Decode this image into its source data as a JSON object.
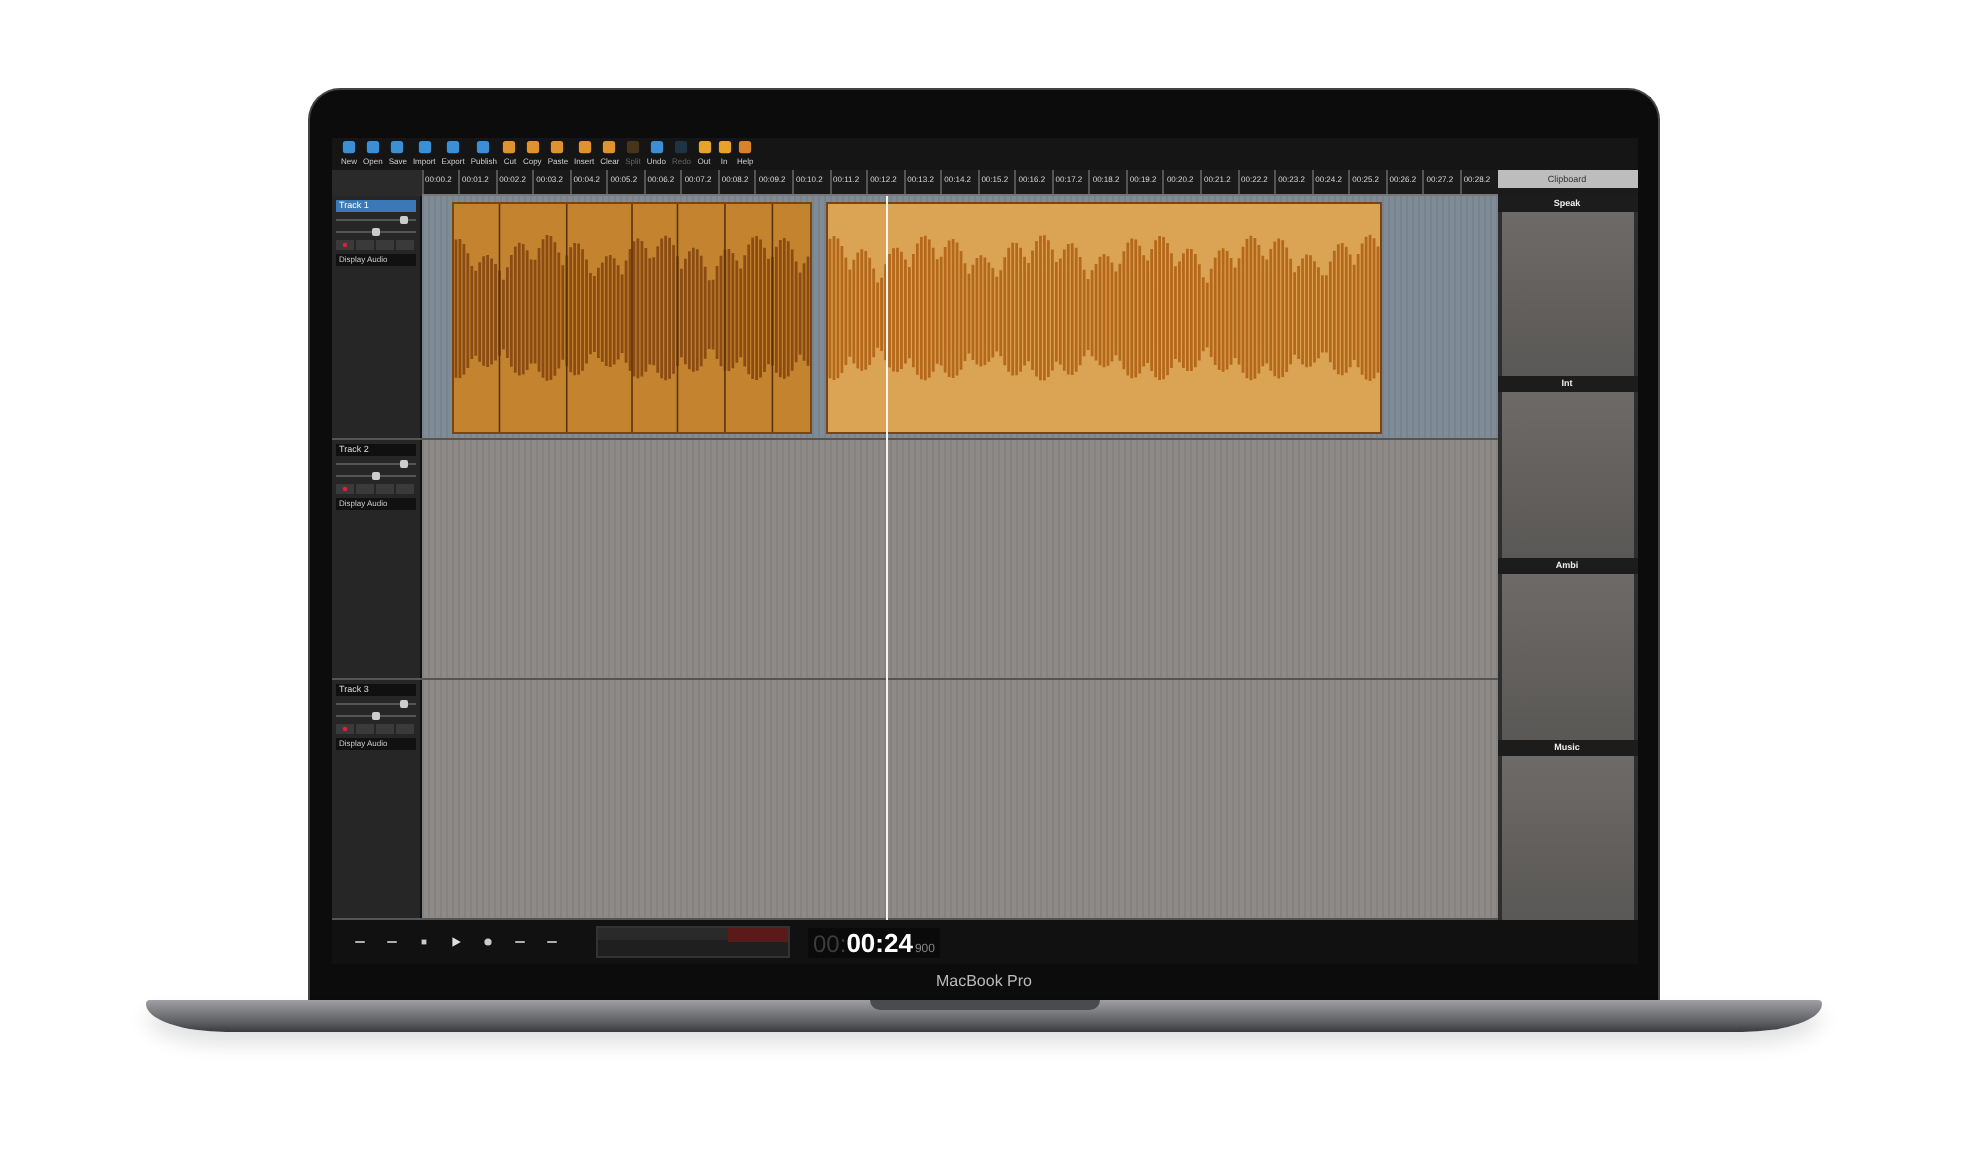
{
  "toolbar": [
    {
      "label": "New",
      "kind": "file",
      "disabled": false
    },
    {
      "label": "Open",
      "kind": "file",
      "disabled": false
    },
    {
      "label": "Save",
      "kind": "file",
      "disabled": false
    },
    {
      "label": "Import",
      "kind": "file",
      "disabled": false
    },
    {
      "label": "Export",
      "kind": "file",
      "disabled": false
    },
    {
      "label": "Publish",
      "kind": "file",
      "disabled": false
    },
    {
      "label": "Cut",
      "kind": "edit",
      "disabled": false
    },
    {
      "label": "Copy",
      "kind": "edit",
      "disabled": false
    },
    {
      "label": "Paste",
      "kind": "edit",
      "disabled": false
    },
    {
      "label": "Insert",
      "kind": "edit",
      "disabled": false
    },
    {
      "label": "Clear",
      "kind": "edit",
      "disabled": false
    },
    {
      "label": "Split",
      "kind": "edit",
      "disabled": true
    },
    {
      "label": "Undo",
      "kind": "history",
      "disabled": false
    },
    {
      "label": "Redo",
      "kind": "history",
      "disabled": true
    },
    {
      "label": "Out",
      "kind": "zoom",
      "disabled": false
    },
    {
      "label": "In",
      "kind": "zoom",
      "disabled": false
    },
    {
      "label": "Help",
      "kind": "help",
      "disabled": false
    }
  ],
  "ruler": [
    "00:00.2",
    "00:01.2",
    "00:02.2",
    "00:03.2",
    "00:04.2",
    "00:05.2",
    "00:06.2",
    "00:07.2",
    "00:08.2",
    "00:09.2",
    "00:10.2",
    "00:11.2",
    "00:12.2",
    "00:13.2",
    "00:14.2",
    "00:15.2",
    "00:16.2",
    "00:17.2",
    "00:18.2",
    "00:19.2",
    "00:20.2",
    "00:21.2",
    "00:22.2",
    "00:23.2",
    "00:24.2",
    "00:25.2",
    "00:26.2",
    "00:27.2",
    "00:28.2"
  ],
  "tracks": [
    {
      "name": "Track 1",
      "selected": true,
      "volume": {
        "level": 0.85
      },
      "pan": {
        "level": 0.5
      },
      "display": "Display Audio",
      "clips": [
        {
          "selected": false
        },
        {
          "selected": true
        }
      ]
    },
    {
      "name": "Track 2",
      "selected": false,
      "volume": {
        "level": 0.85
      },
      "pan": {
        "level": 0.5
      },
      "display": "Display Audio"
    },
    {
      "name": "Track 3",
      "selected": false,
      "volume": {
        "level": 0.85
      },
      "pan": {
        "level": 0.5
      },
      "display": "Display Audio"
    }
  ],
  "clipboard": {
    "title": "Clipboard",
    "slots": [
      {
        "label": "Speak"
      },
      {
        "label": "Int"
      },
      {
        "label": "Ambi"
      },
      {
        "label": "Music"
      }
    ]
  },
  "transport": {
    "time_prefix": "00:",
    "time": "00:24",
    "time_fraction": "900"
  },
  "laptop": {
    "model": "MacBook Pro"
  }
}
